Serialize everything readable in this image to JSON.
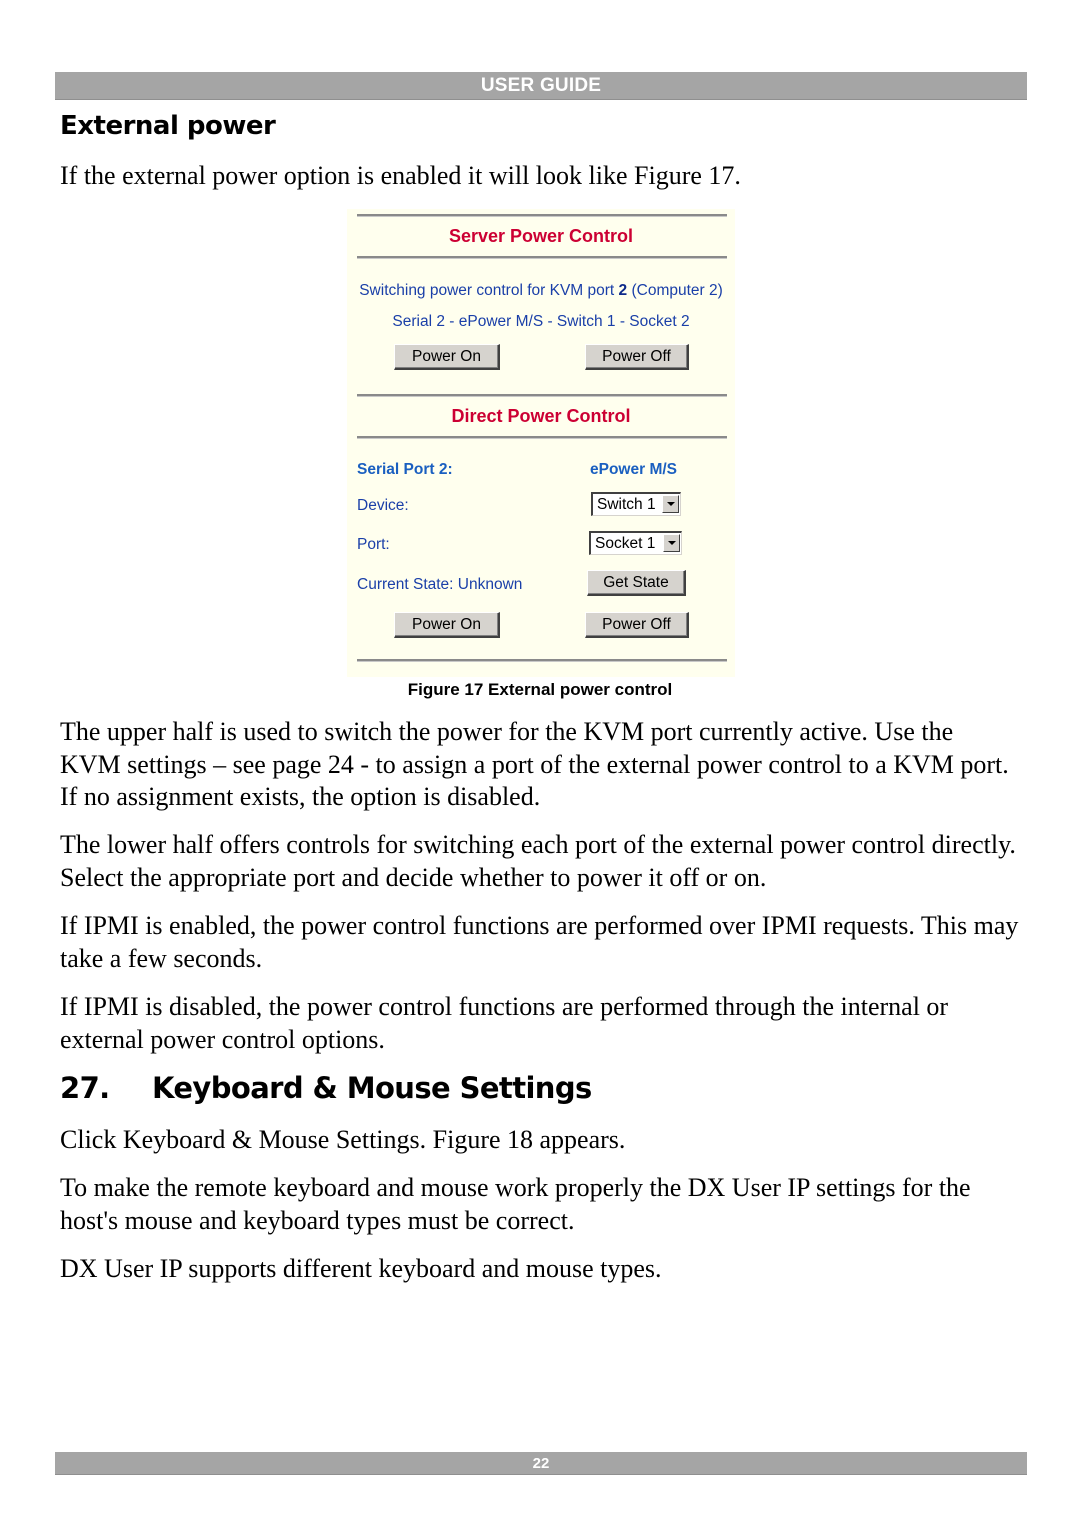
{
  "header": {
    "label": "USER GUIDE"
  },
  "section": {
    "title": "External power",
    "intro": "If the external power option is enabled it will look like Figure 17."
  },
  "figure": {
    "server_power": {
      "title": "Server Power Control",
      "line1_prefix": "Switching power control for KVM port ",
      "line1_port": "2",
      "line1_suffix": " (Computer 2)",
      "line2": "Serial 2 - ePower M/S - Switch 1 - Socket 2",
      "power_on_label": "Power On",
      "power_off_label": "Power Off"
    },
    "direct_power": {
      "title": "Direct Power Control",
      "serial_port_label": "Serial Port 2:",
      "device_type": "ePower M/S",
      "device_label": "Device:",
      "device_value": "Switch 1",
      "port_label": "Port:",
      "port_value": "Socket 1",
      "current_state": "Current State: Unknown",
      "get_state_label": "Get State",
      "power_on_label": "Power On",
      "power_off_label": "Power Off"
    },
    "caption": "Figure 17 External power control"
  },
  "paragraphs": [
    "The upper half is used to switch the power for the KVM port currently active. Use the KVM settings – see page 24 - to assign a port of the external power control to a KVM port. If no assignment exists, the option is disabled.",
    "The lower half offers controls for switching each port of the external power control directly. Select the appropriate port and decide whether to power it off or on.",
    "If IPMI is enabled, the power control functions are performed over IPMI requests. This may take a few seconds.",
    "If IPMI is disabled, the power control functions are performed through the internal or external power control options."
  ],
  "section27": {
    "number": "27.",
    "title": "Keyboard & Mouse Settings",
    "paragraphs": [
      "Click Keyboard & Mouse Settings. Figure 18 appears.",
      "To make the remote keyboard and mouse work properly the DX User IP settings for the host's mouse and keyboard types must be correct.",
      "DX User IP supports different keyboard and mouse types."
    ]
  },
  "footer": {
    "page_number": "22"
  }
}
